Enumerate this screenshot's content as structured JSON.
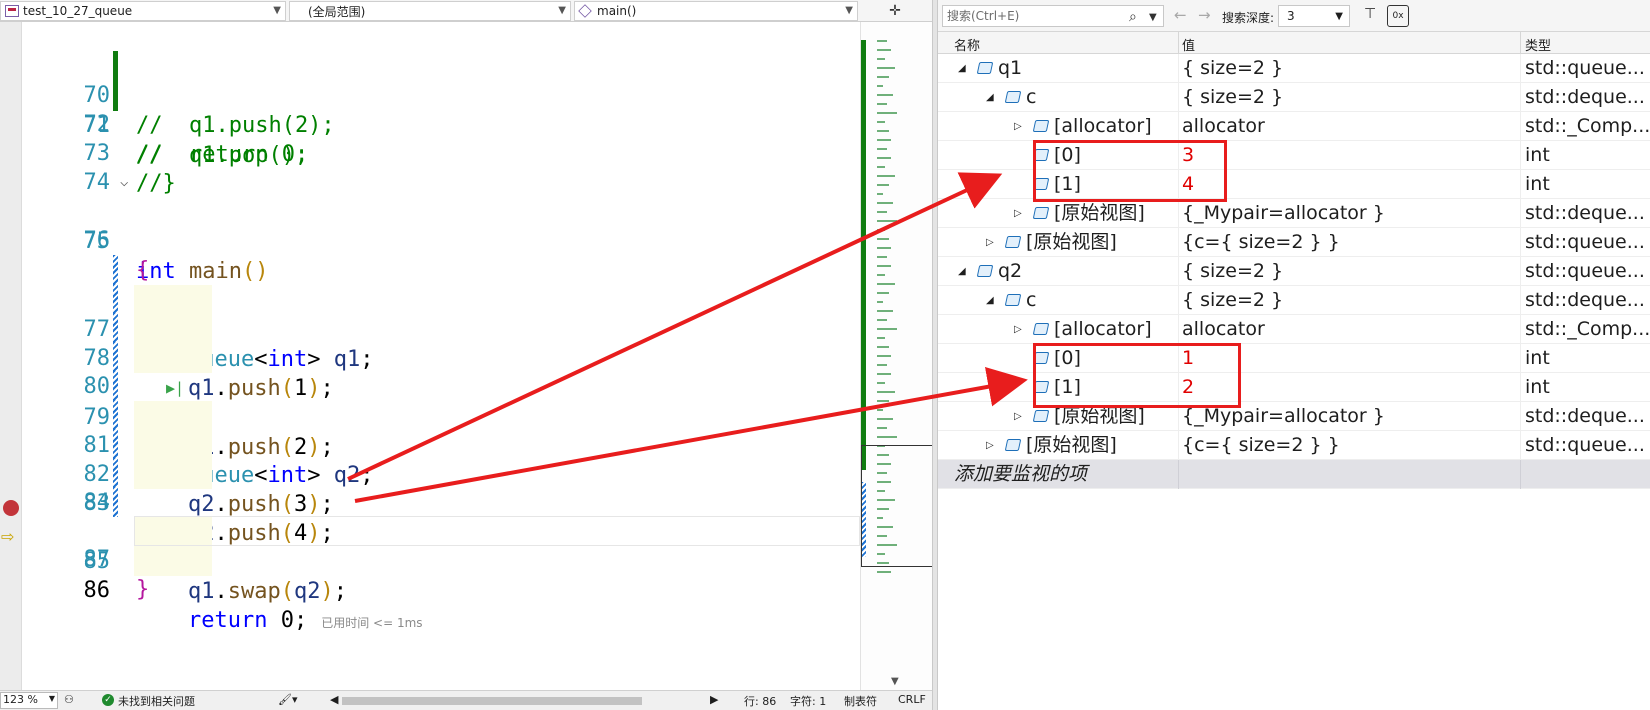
{
  "editor": {
    "nav": {
      "project": "test_10_27_queue",
      "scope": "(全局范围)",
      "member": "main()",
      "split_icon": "split-icon"
    },
    "lines": [
      {
        "n": "70",
        "text": "//  q1.push(2);"
      },
      {
        "n": "71",
        "text": "//  q1.pop();"
      },
      {
        "n": "72",
        "text": "//  return 0;"
      },
      {
        "n": "73",
        "text": "//}"
      },
      {
        "n": "74",
        "text": ""
      },
      {
        "n": "75",
        "text": "int main()"
      },
      {
        "n": "76",
        "text": "{"
      },
      {
        "n": "77",
        "text": "queue<int> q1;"
      },
      {
        "n": "78",
        "text": "q1.push(1);"
      },
      {
        "n": "79",
        "text": "q1.push(2);"
      },
      {
        "n": "80",
        "text": ""
      },
      {
        "n": "81",
        "text": "queue<int> q2;"
      },
      {
        "n": "82",
        "text": "q2.push(3);"
      },
      {
        "n": "83",
        "text": "q2.push(4);"
      },
      {
        "n": "84",
        "text": ""
      },
      {
        "n": "85",
        "text": "q1.swap(q2);"
      },
      {
        "n": "86",
        "text": "return 0;"
      },
      {
        "n": "87",
        "text": "}"
      }
    ],
    "perf_hint": "已用时间 <= 1ms",
    "status": {
      "zoom": "123 %",
      "issues": "未找到相关问题",
      "line": "行: 86",
      "char": "字符: 1",
      "indent": "制表符",
      "eol": "CRLF"
    }
  },
  "watch": {
    "search_placeholder": "搜索(Ctrl+E)",
    "depth_label": "搜索深度:",
    "depth_value": "3",
    "columns": {
      "name": "名称",
      "value": "值",
      "type": "类型"
    },
    "rows": [
      {
        "name": "q1",
        "value": "{ size=2 }",
        "type": "std::queue...",
        "level": 0,
        "expander": "open"
      },
      {
        "name": "c",
        "value": "{ size=2 }",
        "type": "std::deque...",
        "level": 1,
        "expander": "open"
      },
      {
        "name": "[allocator]",
        "value": "allocator",
        "type": "std::_Comp...",
        "level": 2,
        "expander": "closed"
      },
      {
        "name": "[0]",
        "value": "3",
        "type": "int",
        "level": 2,
        "expander": "none",
        "changed": true
      },
      {
        "name": "[1]",
        "value": "4",
        "type": "int",
        "level": 2,
        "expander": "none",
        "changed": true
      },
      {
        "name": "[原始视图]",
        "value": "{_Mypair=allocator }",
        "type": "std::deque...",
        "level": 2,
        "expander": "closed"
      },
      {
        "name": "[原始视图]",
        "value": "{c={ size=2 } }",
        "type": "std::queue...",
        "level": 1,
        "expander": "closed"
      },
      {
        "name": "q2",
        "value": "{ size=2 }",
        "type": "std::queue...",
        "level": 0,
        "expander": "open"
      },
      {
        "name": "c",
        "value": "{ size=2 }",
        "type": "std::deque...",
        "level": 1,
        "expander": "open"
      },
      {
        "name": "[allocator]",
        "value": "allocator",
        "type": "std::_Comp...",
        "level": 2,
        "expander": "closed"
      },
      {
        "name": "[0]",
        "value": "1",
        "type": "int",
        "level": 2,
        "expander": "none",
        "changed": true
      },
      {
        "name": "[1]",
        "value": "2",
        "type": "int",
        "level": 2,
        "expander": "none",
        "changed": true
      },
      {
        "name": "[原始视图]",
        "value": "{_Mypair=allocator }",
        "type": "std::deque...",
        "level": 2,
        "expander": "closed"
      },
      {
        "name": "[原始视图]",
        "value": "{c={ size=2 } }",
        "type": "std::queue...",
        "level": 1,
        "expander": "closed"
      }
    ],
    "add_item": "添加要监视的项"
  },
  "colors": {
    "annotation_red": "#e81d1d",
    "changed_value": "#e00000",
    "comment_green": "#008000",
    "keyword_blue": "#0000ff",
    "breakpoint": "#c2343a"
  }
}
